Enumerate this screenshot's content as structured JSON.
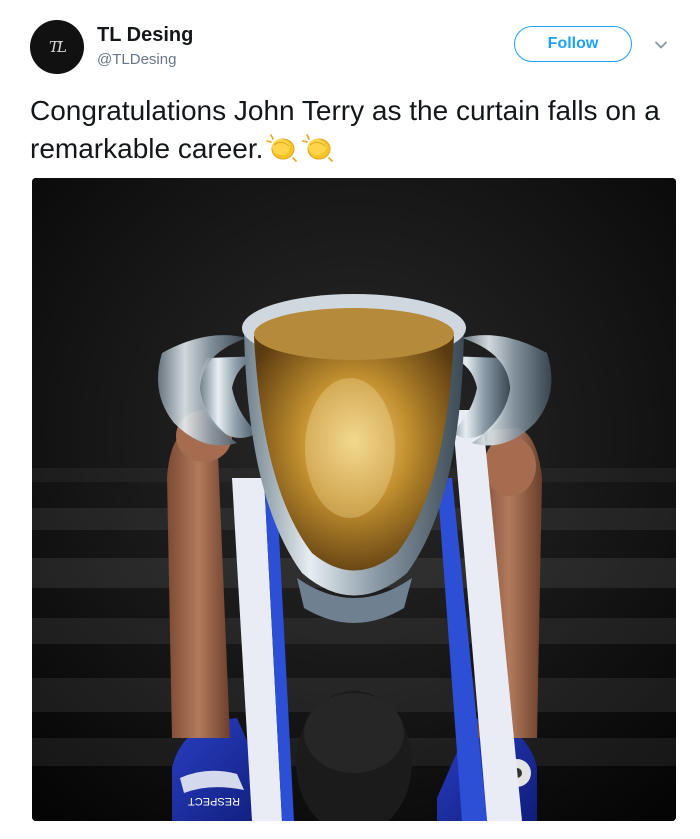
{
  "tweet": {
    "author": {
      "display_name": "TL Desing",
      "handle": "@TLDesing",
      "avatar_text": "TL"
    },
    "follow_label": "Follow",
    "text": "Congratulations John Terry as the curtain falls on a remarkable career.",
    "emojis": [
      "clapping-hands",
      "clapping-hands"
    ],
    "media": {
      "sleeve_patch_text": "RESPECT"
    }
  },
  "colors": {
    "accent": "#1da1f2",
    "text": "#14171a",
    "muted": "#657786"
  },
  "icons": {
    "more": "chevron-down-icon"
  }
}
